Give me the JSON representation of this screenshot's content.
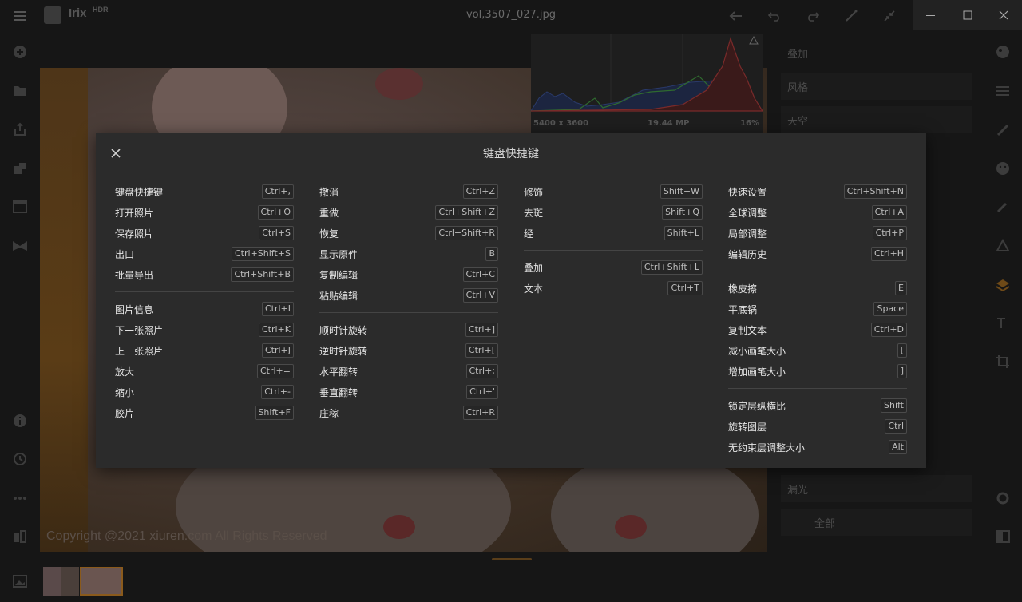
{
  "titlebar": {
    "app_name": "Irix",
    "app_name_sup": "HDR",
    "filename": "vol,3507_027.jpg"
  },
  "canvas": {
    "watermark": "Copyright @2021  xiuren.com  All Rights Reserved"
  },
  "histogram": {
    "dimensions": "5400 x 3600",
    "megapixels": "19.44 MP",
    "zoom": "16%"
  },
  "right_panel": {
    "items": [
      "叠加",
      "风格",
      "天空",
      "漏光",
      "全部"
    ]
  },
  "modal": {
    "title": "键盘快捷键",
    "columns": [
      {
        "groups": [
          [
            {
              "label": "键盘快捷键",
              "key": "Ctrl+,"
            },
            {
              "label": "打开照片",
              "key": "Ctrl+O"
            },
            {
              "label": "保存照片",
              "key": "Ctrl+S"
            },
            {
              "label": "出口",
              "key": "Ctrl+Shift+S"
            },
            {
              "label": "批量导出",
              "key": "Ctrl+Shift+B"
            }
          ],
          [
            {
              "label": "图片信息",
              "key": "Ctrl+I"
            },
            {
              "label": "下一张照片",
              "key": "Ctrl+K"
            },
            {
              "label": "上一张照片",
              "key": "Ctrl+J"
            },
            {
              "label": "放大",
              "key": "Ctrl+="
            },
            {
              "label": "缩小",
              "key": "Ctrl+-"
            },
            {
              "label": "胶片",
              "key": "Shift+F"
            }
          ]
        ]
      },
      {
        "groups": [
          [
            {
              "label": "撤消",
              "key": "Ctrl+Z"
            },
            {
              "label": "重做",
              "key": "Ctrl+Shift+Z"
            },
            {
              "label": "恢复",
              "key": "Ctrl+Shift+R"
            },
            {
              "label": "显示原件",
              "key": "B"
            },
            {
              "label": "复制编辑",
              "key": "Ctrl+C"
            },
            {
              "label": "粘贴编辑",
              "key": "Ctrl+V"
            }
          ],
          [
            {
              "label": "顺时针旋转",
              "key": "Ctrl+]"
            },
            {
              "label": "逆时针旋转",
              "key": "Ctrl+["
            },
            {
              "label": "水平翻转",
              "key": "Ctrl+;"
            },
            {
              "label": "垂直翻转",
              "key": "Ctrl+'"
            },
            {
              "label": "庄稼",
              "key": "Ctrl+R"
            }
          ]
        ]
      },
      {
        "groups": [
          [
            {
              "label": "修饰",
              "key": "Shift+W"
            },
            {
              "label": "去斑",
              "key": "Shift+Q"
            },
            {
              "label": "经",
              "key": "Shift+L"
            }
          ],
          [
            {
              "label": "叠加",
              "key": "Ctrl+Shift+L"
            },
            {
              "label": "文本",
              "key": "Ctrl+T"
            }
          ]
        ]
      },
      {
        "groups": [
          [
            {
              "label": "快速设置",
              "key": "Ctrl+Shift+N"
            },
            {
              "label": "全球调整",
              "key": "Ctrl+A"
            },
            {
              "label": "局部调整",
              "key": "Ctrl+P"
            },
            {
              "label": "编辑历史",
              "key": "Ctrl+H"
            }
          ],
          [
            {
              "label": "橡皮擦",
              "key": "E"
            },
            {
              "label": "平底锅",
              "key": "Space"
            },
            {
              "label": "复制文本",
              "key": "Ctrl+D"
            },
            {
              "label": "减小画笔大小",
              "key": "["
            },
            {
              "label": "增加画笔大小",
              "key": "]"
            }
          ],
          [
            {
              "label": "锁定层纵横比",
              "key": "Shift"
            },
            {
              "label": "旋转图层",
              "key": "Ctrl"
            },
            {
              "label": "无约束层调整大小",
              "key": "Alt"
            }
          ]
        ]
      }
    ]
  }
}
